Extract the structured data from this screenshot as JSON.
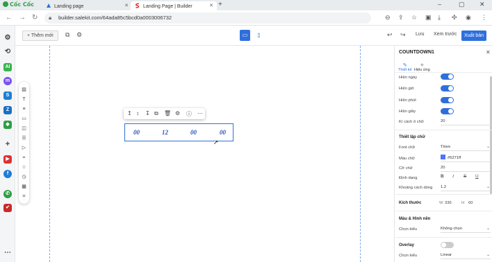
{
  "browser": {
    "brand": "Cốc Cốc",
    "tabs": [
      {
        "label": "Landing page",
        "active": false
      },
      {
        "label": "Landing Page | Builder",
        "active": true
      }
    ],
    "url": "builder.salekit.com/64ada85c5bcd0a0003006732",
    "window_controls": [
      "minimize-icon",
      "maximize-icon",
      "close-icon"
    ]
  },
  "builder_toolbar": {
    "add_label": "+ Thêm mới",
    "save_label": "Lưu",
    "preview_label": "Xem trước",
    "publish_label": "Xuất bản",
    "device": "desktop"
  },
  "countdown": {
    "values": [
      "00",
      "12",
      "00",
      "00"
    ],
    "color": "#2a52be"
  },
  "panel": {
    "title": "COUNTDOWN1",
    "tabs": [
      {
        "label": "Thiết kế",
        "icon": "pencil-icon",
        "active": true
      },
      {
        "label": "Hiệu ứng",
        "icon": "magic-icon",
        "active": false
      }
    ],
    "toggles": [
      {
        "label": "Hiện ngày",
        "on": true
      },
      {
        "label": "Hiện giờ",
        "on": true
      },
      {
        "label": "Hiện phút",
        "on": true
      },
      {
        "label": "Hiện giây",
        "on": true
      }
    ],
    "spacing_label": "Kí cách ô chữ",
    "spacing_value": "20",
    "font_section": "Thiết lập chữ",
    "font_label": "Font chữ",
    "font_value": "Times",
    "color_label": "Màu chữ",
    "color_value": "#5271ff",
    "size_label": "Cỡ chữ",
    "size_value": "20",
    "format_label": "Định dạng",
    "format_buttons": [
      "B",
      "I",
      "S",
      "U"
    ],
    "line_height_label": "Khoảng cách dòng",
    "line_height_value": "1.2",
    "dimension_label": "Kích thước",
    "width_label": "W",
    "width_value": "336",
    "height_label": "H",
    "height_value": "60",
    "bg_section": "Màu & Hình nền",
    "bg_choose_label": "Chọn kiểu",
    "bg_choose_value": "Không chọn",
    "overlay_label": "Overlay",
    "overlay_on": false,
    "overlay_choose_label": "Chọn kiểu",
    "overlay_choose_value": "Linear"
  }
}
